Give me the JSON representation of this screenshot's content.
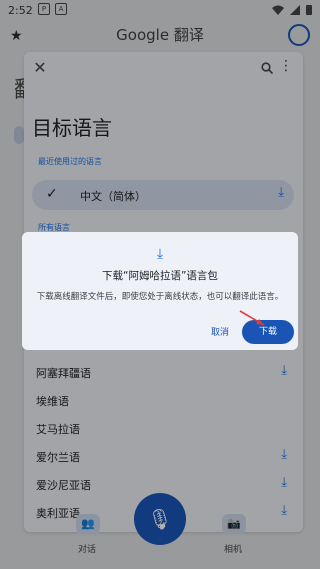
{
  "status": {
    "time": "2:52",
    "icons": [
      "P",
      "A"
    ]
  },
  "header": {
    "title": "Google 翻译"
  },
  "background": {
    "letter": "翻"
  },
  "sheet": {
    "title": "目标语言",
    "recent_heading": "最近使用过的语言",
    "selected": "中文（简体）",
    "all_heading": "所有语言",
    "languages": [
      "阿塞拜疆语",
      "埃维语",
      "艾马拉语",
      "爱尔兰语",
      "爱沙尼亚语",
      "奥利亚语"
    ]
  },
  "dialog": {
    "title": "下载“阿姆哈拉语”语言包",
    "message": "下载离线翻译文件后，即使您处于离线状态，也可以翻译此语言。",
    "cancel_label": "取消",
    "download_label": "下载"
  },
  "bottom": {
    "conversation_label": "对话",
    "camera_label": "相机"
  },
  "colors": {
    "accent": "#1a54b5",
    "link": "#1a73e8",
    "arrow": "#e53935"
  }
}
